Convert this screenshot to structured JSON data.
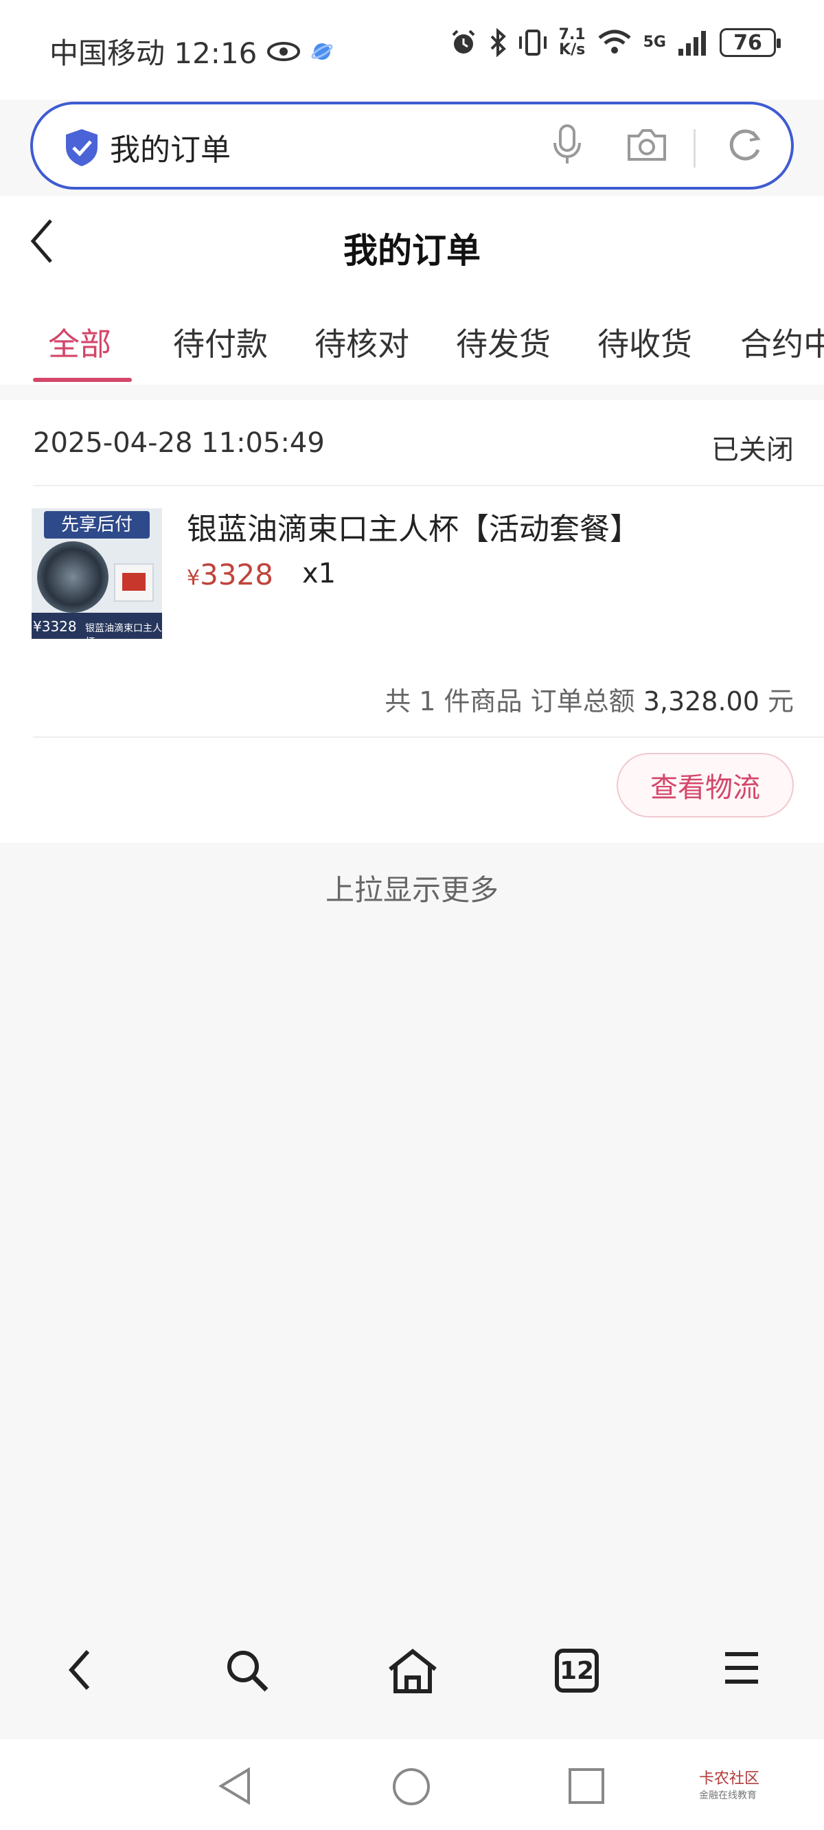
{
  "status_bar": {
    "carrier_time": "中国移动 12:16",
    "speed_top": "7.1",
    "speed_bottom": "K/s",
    "network": "5G",
    "battery": "76"
  },
  "search": {
    "query": "我的订单"
  },
  "header": {
    "title": "我的订单"
  },
  "tabs": [
    {
      "label": "全部",
      "active": true
    },
    {
      "label": "待付款"
    },
    {
      "label": "待核对"
    },
    {
      "label": "待发货"
    },
    {
      "label": "待收货"
    },
    {
      "label": "合约中"
    }
  ],
  "order": {
    "time": "2025-04-28 11:05:49",
    "status": "已关闭",
    "thumb_badge": "先享后付",
    "thumb_price": "¥3328",
    "thumb_caption": "银蓝油滴束口主人杯",
    "product_name": "银蓝油滴束口主人杯【活动套餐】",
    "price_symbol": "¥",
    "price": "3328",
    "qty": "x1",
    "summary_prefix": "共 1 件商品 订单总额 ",
    "summary_amount": "3,328.00",
    "summary_unit": " 元",
    "logistics_label": "查看物流"
  },
  "load_more": "上拉显示更多",
  "toolbar": {
    "tab_count": "12"
  },
  "watermark": {
    "line1": "卡农社区",
    "line2": "金融在线教育"
  },
  "colors": {
    "accent": "#d4466a",
    "search_border": "#3e5bd1",
    "price": "#c0443c"
  }
}
